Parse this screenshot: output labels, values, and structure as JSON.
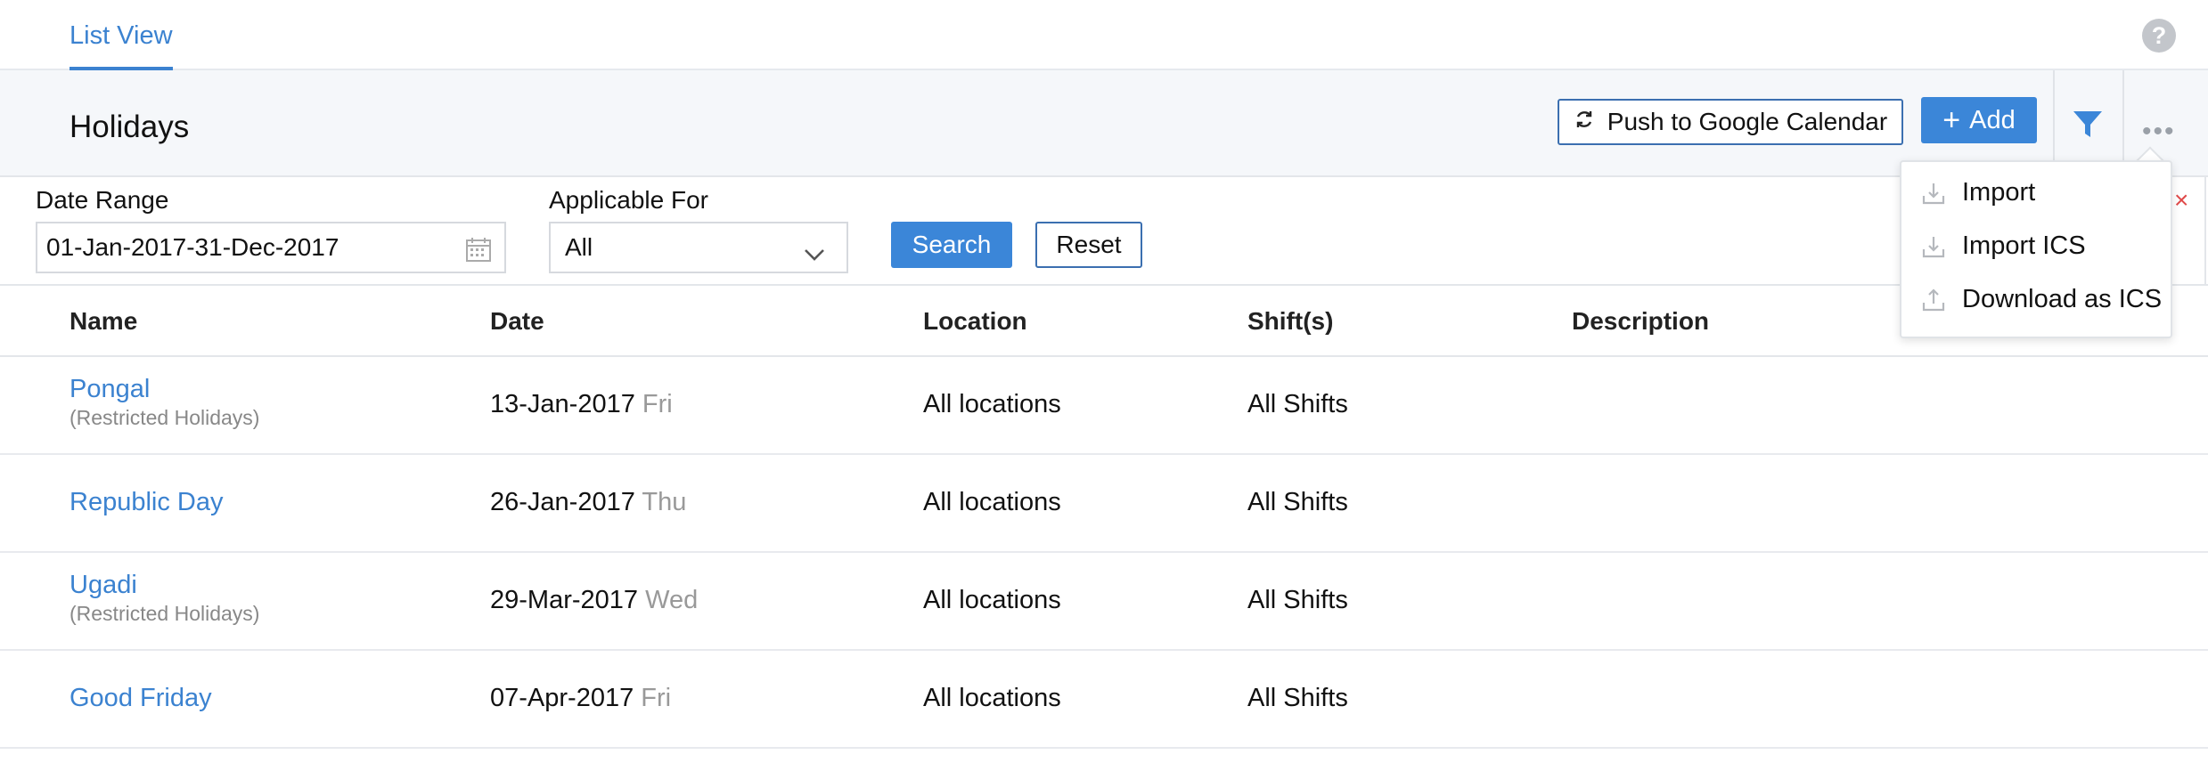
{
  "tabs": {
    "active_label": "List View"
  },
  "help": {
    "label": "?"
  },
  "header": {
    "title": "Holidays",
    "push_label": "Push to Google Calendar",
    "add_label": "Add",
    "more_label": "•••"
  },
  "filters": {
    "date_range_label": "Date Range",
    "date_range_value": "01-Jan-2017-31-Dec-2017",
    "applicable_label": "Applicable For",
    "applicable_value": "All",
    "search_label": "Search",
    "reset_label": "Reset",
    "close_label": "×"
  },
  "table": {
    "columns": [
      "Name",
      "Date",
      "Location",
      "Shift(s)",
      "Description"
    ],
    "rows": [
      {
        "name": "Pongal",
        "sub": "(Restricted Holidays)",
        "date": "13-Jan-2017",
        "day": "Fri",
        "location": "All locations",
        "shifts": "All Shifts",
        "description": ""
      },
      {
        "name": "Republic Day",
        "sub": "",
        "date": "26-Jan-2017",
        "day": "Thu",
        "location": "All locations",
        "shifts": "All Shifts",
        "description": ""
      },
      {
        "name": "Ugadi",
        "sub": "(Restricted Holidays)",
        "date": "29-Mar-2017",
        "day": "Wed",
        "location": "All locations",
        "shifts": "All Shifts",
        "description": ""
      },
      {
        "name": "Good Friday",
        "sub": "",
        "date": "07-Apr-2017",
        "day": "Fri",
        "location": "All locations",
        "shifts": "All Shifts",
        "description": ""
      }
    ]
  },
  "menu": {
    "items": [
      {
        "label": "Import",
        "icon": "import-icon"
      },
      {
        "label": "Import ICS",
        "icon": "import-icon"
      },
      {
        "label": "Download as ICS",
        "icon": "upload-icon"
      }
    ]
  },
  "colors": {
    "accent": "#3b86d8",
    "link": "#3b82d0",
    "close": "#e04a4a"
  }
}
